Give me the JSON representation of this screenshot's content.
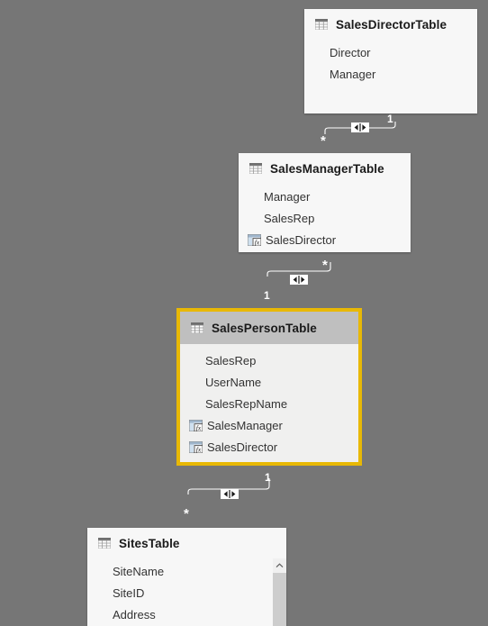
{
  "canvas": {
    "background_color": "#767676",
    "selection_color": "#e8b805"
  },
  "tables": [
    {
      "name": "SalesDirectorTable",
      "icon": "table-grid-icon",
      "selected": false,
      "fields": [
        {
          "name": "Director",
          "kind": "column"
        },
        {
          "name": "Manager",
          "kind": "column"
        }
      ]
    },
    {
      "name": "SalesManagerTable",
      "icon": "table-grid-icon",
      "selected": false,
      "fields": [
        {
          "name": "Manager",
          "kind": "column"
        },
        {
          "name": "SalesRep",
          "kind": "column"
        },
        {
          "name": "SalesDirector",
          "kind": "calculated-column"
        }
      ]
    },
    {
      "name": "SalesPersonTable",
      "icon": "table-grid-icon",
      "selected": true,
      "fields": [
        {
          "name": "SalesRep",
          "kind": "column"
        },
        {
          "name": "UserName",
          "kind": "column"
        },
        {
          "name": "SalesRepName",
          "kind": "column"
        },
        {
          "name": "SalesManager",
          "kind": "calculated-column"
        },
        {
          "name": "SalesDirector",
          "kind": "calculated-column"
        }
      ]
    },
    {
      "name": "SitesTable",
      "icon": "table-grid-icon",
      "selected": false,
      "scrollbar": true,
      "fields": [
        {
          "name": "SiteName",
          "kind": "column"
        },
        {
          "name": "SiteID",
          "kind": "column"
        },
        {
          "name": "Address",
          "kind": "column"
        }
      ]
    }
  ],
  "relationships": [
    {
      "id": "director-manager",
      "from_table": "SalesManagerTable",
      "to_table": "SalesDirectorTable",
      "from_cardinality": "*",
      "to_cardinality": "1",
      "cross_filter": "both",
      "cross_filter_icon": "bidirectional-filter-icon"
    },
    {
      "id": "manager-person",
      "from_table": "SalesManagerTable",
      "to_table": "SalesPersonTable",
      "from_cardinality": "*",
      "to_cardinality": "1",
      "cross_filter": "both",
      "cross_filter_icon": "bidirectional-filter-icon"
    },
    {
      "id": "person-sites",
      "from_table": "SitesTable",
      "to_table": "SalesPersonTable",
      "from_cardinality": "*",
      "to_cardinality": "1",
      "cross_filter": "both",
      "cross_filter_icon": "bidirectional-filter-icon"
    }
  ],
  "cardinality_labels": {
    "one": "1",
    "many": "*"
  },
  "scrollbar": {
    "up_arrow_icon": "chevron-up-icon"
  }
}
